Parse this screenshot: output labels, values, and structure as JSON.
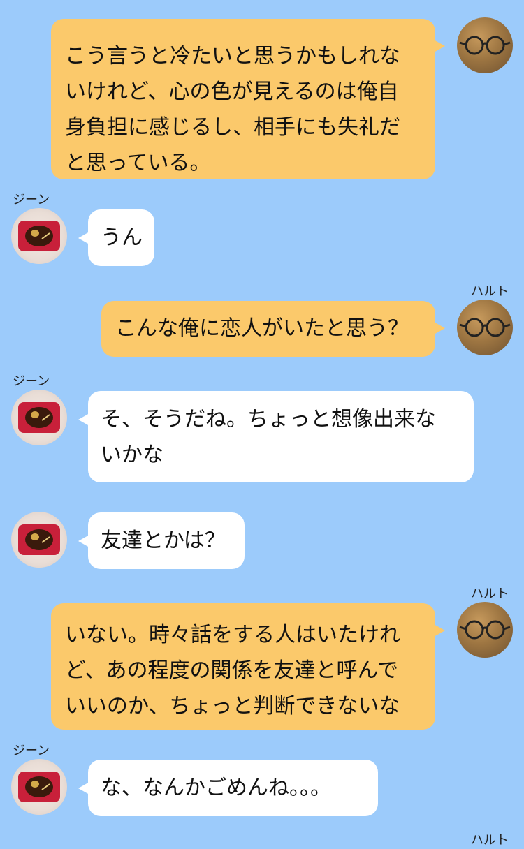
{
  "participants": {
    "left": {
      "name": "ジーン",
      "avatar_icon": "chocolate-package-icon"
    },
    "right": {
      "name": "ハルト",
      "avatar_icon": "glasses-icon"
    }
  },
  "messages": [
    {
      "side": "right",
      "lines": [
        "こう言うと冷たいと思うかもしれな",
        "いけれど、心の色が見えるのは俺自",
        "身負担に感じるし、相手にも失礼だ",
        "と思っている。"
      ]
    },
    {
      "side": "left",
      "sender": "ジーン",
      "lines": [
        "うん"
      ]
    },
    {
      "side": "right",
      "sender": "ハルト",
      "lines": [
        "こんな俺に恋人がいたと思う？"
      ]
    },
    {
      "side": "left",
      "sender": "ジーン",
      "lines": [
        "そ、そうだね。ちょっと想像出来な",
        "いかな"
      ]
    },
    {
      "side": "left",
      "lines": [
        "友達とかは？"
      ]
    },
    {
      "side": "right",
      "sender": "ハルト",
      "lines": [
        "いない。時々話をする人はいたけれ",
        "ど、あの程度の関係を友達と呼んで",
        "いいのか、ちょっと判断できないな"
      ]
    },
    {
      "side": "left",
      "sender": "ジーン",
      "lines": [
        "な、なんかごめんね。。。"
      ]
    }
  ],
  "trailing_sender": "ハルト",
  "colors": {
    "background": "#9ccbfb",
    "right_bubble": "#fbc96b",
    "left_bubble": "#ffffff"
  }
}
